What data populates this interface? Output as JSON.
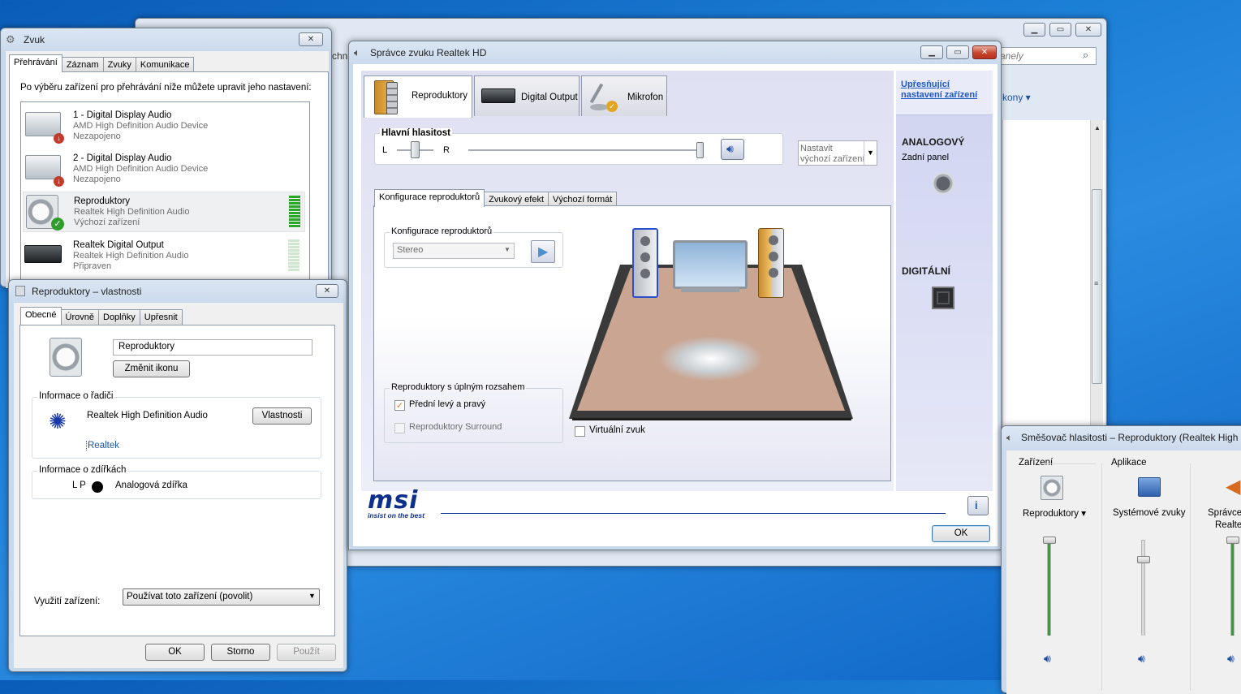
{
  "bg_window": {
    "left_text": "chn",
    "search_placeholder": "anely",
    "dropdown_text": "kony ▾"
  },
  "zvuk": {
    "title": "Zvuk",
    "tabs": [
      "Přehrávání",
      "Záznam",
      "Zvuky",
      "Komunikace"
    ],
    "description": "Po výběru zařízení pro přehrávání níže můžete upravit jeho nastavení:",
    "devices": [
      {
        "name": "1 - Digital Display Audio",
        "driver": "AMD High Definition Audio Device",
        "status": "Nezapojeno"
      },
      {
        "name": "2 - Digital Display Audio",
        "driver": "AMD High Definition Audio Device",
        "status": "Nezapojeno"
      },
      {
        "name": "Reproduktory",
        "driver": "Realtek High Definition Audio",
        "status": "Výchozí zařízení"
      },
      {
        "name": "Realtek Digital Output",
        "driver": "Realtek High Definition Audio",
        "status": "Připraven"
      }
    ]
  },
  "props": {
    "title": "Reproduktory – vlastnosti",
    "tabs": [
      "Obecné",
      "Úrovně",
      "Doplňky",
      "Upřesnit"
    ],
    "name_value": "Reproduktory",
    "change_icon": "Změnit ikonu",
    "controller_legend": "Informace o řadiči",
    "controller_name": "Realtek High Definition Audio",
    "properties_button": "Vlastnosti",
    "vendor_link": "Realtek",
    "jack_legend": "Informace o zdířkách",
    "jack_lp": "L P",
    "jack_name": "Analogová zdířka",
    "usage_label": "Využití zařízení:",
    "usage_value": "Používat toto zařízení (povolit)",
    "ok": "OK",
    "cancel": "Storno",
    "apply": "Použít"
  },
  "realtek": {
    "title": "Správce zvuku Realtek HD",
    "device_tabs": [
      "Reproduktory",
      "Digital Output",
      "Mikrofon"
    ],
    "volume_label": "Hlavní hlasitost",
    "left": "L",
    "right": "R",
    "balance": 0.5,
    "volume": 1.0,
    "default_dropdown": [
      "Nastavit",
      "výchozí zařízení"
    ],
    "sub_tabs": [
      "Konfigurace reproduktorů",
      "Zvukový efekt",
      "Výchozí formát"
    ],
    "config_legend": "Konfigurace reproduktorů",
    "config_value": "Stereo",
    "fullrange_legend": "Reproduktory s úplným rozsahem",
    "front_lr": "Přední levý a pravý",
    "surround": "Reproduktory Surround",
    "virtual": "Virtuální zvuk",
    "side_link": [
      "Upřesňující",
      "nastavení zařízení"
    ],
    "analog_heading": "ANALOGOVÝ",
    "analog_sub": "Zadní panel",
    "digital_heading": "DIGITÁLNÍ",
    "brand": "msi",
    "brand_slogan": "insist on the best",
    "ok": "OK",
    "accent_color": "#0e2f8c"
  },
  "mixer": {
    "title": "Směšovač hlasitosti – Reproduktory (Realtek High D",
    "device_heading": "Zařízení",
    "apps_heading": "Aplikace",
    "channels": [
      {
        "label": "Reproduktory ▾",
        "level": 1.0
      },
      {
        "label": "Systémové zvuky",
        "level": 0.8
      },
      {
        "label": "Správce",
        "label2": "Realte",
        "level": 1.0
      }
    ]
  }
}
